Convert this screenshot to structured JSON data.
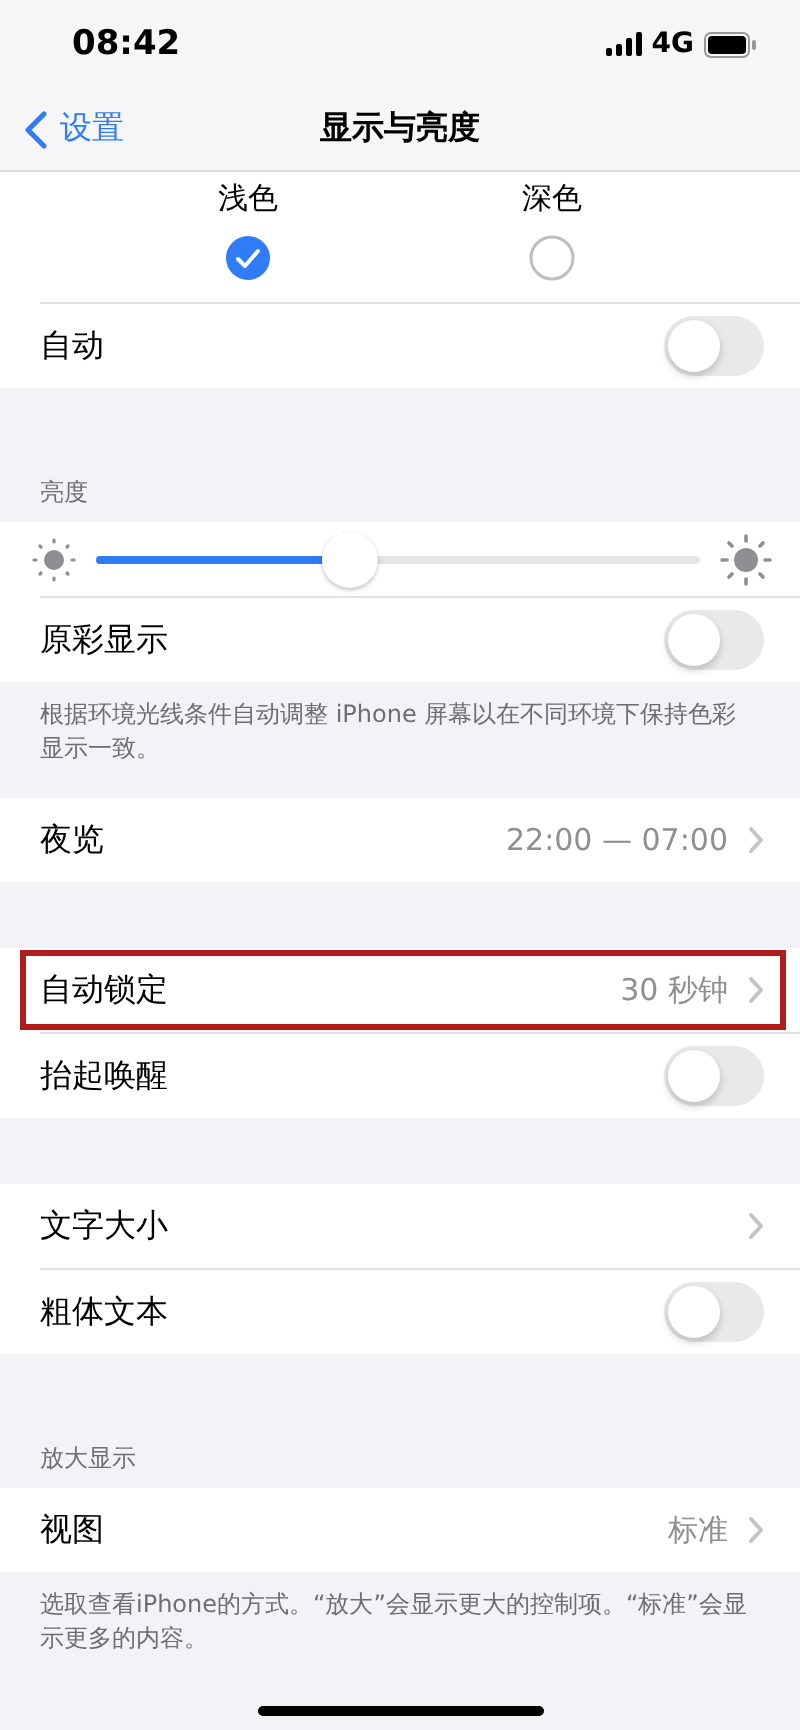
{
  "status_bar": {
    "time": "08:42",
    "network": "4G"
  },
  "nav": {
    "back": "设置",
    "title": "显示与亮度"
  },
  "groups": [
    {
      "items": [
        {
          "kind": "appearance",
          "options": [
            {
              "label": "浅色",
              "selected": true
            },
            {
              "label": "深色",
              "selected": false
            }
          ]
        },
        {
          "kind": "toggle",
          "label": "自动",
          "on": false
        }
      ]
    },
    {
      "header": "亮度",
      "items": [
        {
          "kind": "slider",
          "level": 0.42
        },
        {
          "kind": "toggle",
          "label": "原彩显示",
          "on": false
        }
      ],
      "footer": "根据环境光线条件自动调整 iPhone 屏幕以在不同环境下保持色彩显示一致。"
    },
    {
      "items": [
        {
          "kind": "link",
          "label": "夜览",
          "value": "22:00 — 07:00"
        }
      ]
    },
    {
      "items": [
        {
          "kind": "link",
          "label": "自动锁定",
          "value": "30 秒钟",
          "highlighted": true
        },
        {
          "kind": "toggle",
          "label": "抬起唤醒",
          "on": false
        }
      ]
    },
    {
      "items": [
        {
          "kind": "link",
          "label": "文字大小"
        },
        {
          "kind": "toggle",
          "label": "粗体文本",
          "on": false
        }
      ]
    },
    {
      "header": "放大显示",
      "items": [
        {
          "kind": "link",
          "label": "视图",
          "value": "标准"
        }
      ],
      "footer": "选取查看iPhone的方式。“放大”会显示更大的控制项。“标准”会显示更多的内容。"
    }
  ]
}
